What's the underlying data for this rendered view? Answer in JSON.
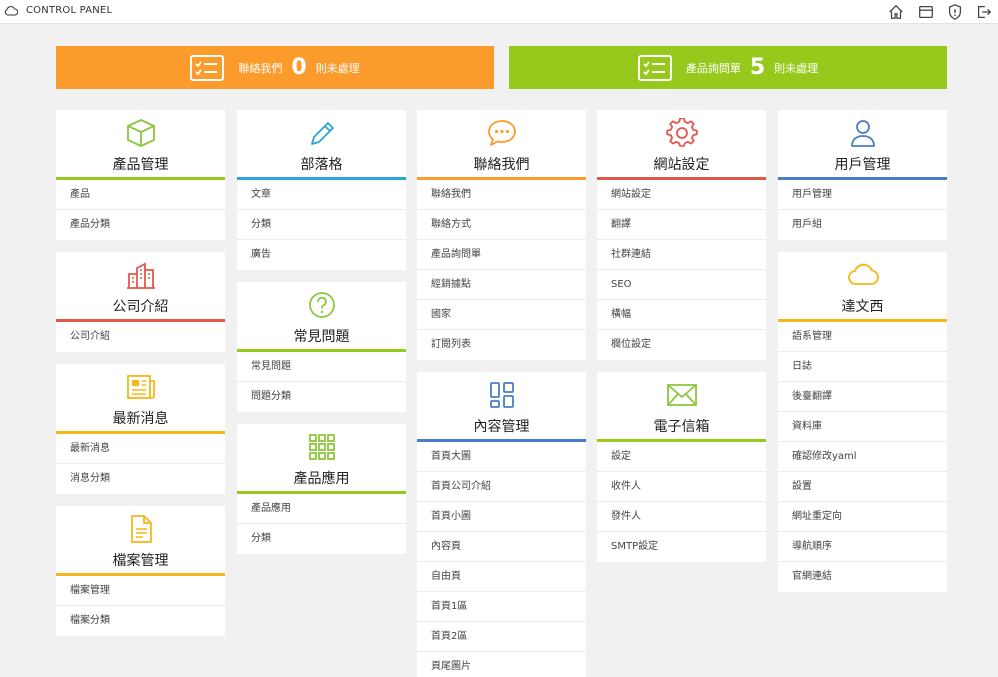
{
  "header": {
    "title": "CONTROL PANEL"
  },
  "icons": {
    "logo": "cloud-icon",
    "toolbar": [
      "home-icon",
      "window-icon",
      "shield-icon",
      "logout-icon"
    ]
  },
  "colors": {
    "orange": "#fb9b2b",
    "green": "#97c91d",
    "red": "#e2574c",
    "blue": "#4a7cc7",
    "yellow": "#f5b818",
    "teal": "#2aa5d8"
  },
  "alerts": [
    {
      "label": "聯絡我們",
      "count": "0",
      "suffix": "則未處理",
      "icon": "checklist-icon"
    },
    {
      "label": "產品詢問單",
      "count": "5",
      "suffix": "則未處理",
      "icon": "checklist-icon"
    }
  ],
  "columns": [
    [
      {
        "title": "產品管理",
        "icon": "box-icon",
        "items": [
          "產品",
          "產品分類"
        ]
      },
      {
        "title": "公司介紹",
        "icon": "building-icon",
        "items": [
          "公司介紹"
        ]
      },
      {
        "title": "最新消息",
        "icon": "newspaper-icon",
        "items": [
          "最新消息",
          "消息分類"
        ]
      },
      {
        "title": "檔案管理",
        "icon": "document-icon",
        "items": [
          "檔案管理",
          "檔案分類"
        ]
      }
    ],
    [
      {
        "title": "部落格",
        "icon": "pencil-icon",
        "items": [
          "文章",
          "分類",
          "廣告"
        ]
      },
      {
        "title": "常見問題",
        "icon": "question-icon",
        "items": [
          "常見問題",
          "問題分類"
        ]
      },
      {
        "title": "產品應用",
        "icon": "grid-icon",
        "items": [
          "產品應用",
          "分類"
        ]
      }
    ],
    [
      {
        "title": "聯絡我們",
        "icon": "chat-icon",
        "items": [
          "聯絡我們",
          "聯絡方式",
          "產品詢問單",
          "經銷據點",
          "國家",
          "訂閱列表"
        ]
      },
      {
        "title": "內容管理",
        "icon": "layout-icon",
        "items": [
          "首頁大圖",
          "首頁公司介紹",
          "首頁小圖",
          "內容頁",
          "自由頁",
          "首頁1區",
          "首頁2區",
          "頁尾圖片"
        ]
      }
    ],
    [
      {
        "title": "網站設定",
        "icon": "gear-icon",
        "items": [
          "網站設定",
          "翻譯",
          "社群連結",
          "SEO",
          "橫幅",
          "欄位設定"
        ]
      },
      {
        "title": "電子信箱",
        "icon": "envelope-icon",
        "items": [
          "設定",
          "收件人",
          "發件人",
          "SMTP設定"
        ]
      }
    ],
    [
      {
        "title": "用戶管理",
        "icon": "user-icon",
        "items": [
          "用戶管理",
          "用戶組"
        ]
      },
      {
        "title": "達文西",
        "icon": "cloud-icon",
        "items": [
          "語系管理",
          "日誌",
          "後臺翻譯",
          "資料庫",
          "確認修改yaml",
          "設置",
          "網址重定向",
          "導航順序",
          "官網連結"
        ]
      }
    ]
  ]
}
